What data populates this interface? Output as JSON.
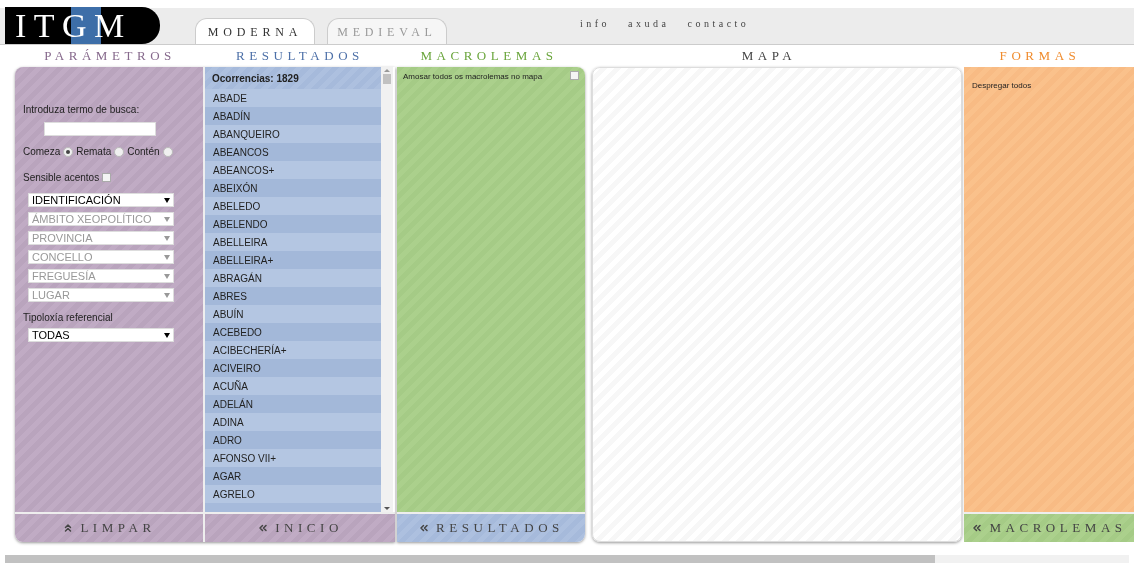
{
  "logo": {
    "text": "ITGM"
  },
  "tabs": [
    {
      "label": "MODERNA",
      "selected": true
    },
    {
      "label": "MEDIEVAL",
      "selected": false
    }
  ],
  "top_links": [
    "info",
    "axuda",
    "contacto"
  ],
  "section_headers": [
    {
      "label": "PARÁMETROS",
      "color": "#86698c"
    },
    {
      "label": "RESULTADOS",
      "color": "#4d70a8"
    },
    {
      "label": "MACROLEMAS",
      "color": "#6aa53c"
    },
    {
      "label": "MAPA",
      "color": "#444444"
    },
    {
      "label": "FORMAS",
      "color": "#f08c2e"
    }
  ],
  "parameters": {
    "search_label": "Introduza termo de busca:",
    "match_options": [
      {
        "label": "Comeza",
        "selected": true
      },
      {
        "label": "Remata",
        "selected": false
      },
      {
        "label": "Contén",
        "selected": false
      }
    ],
    "accent_sensitive": {
      "label": "Sensible acentos",
      "checked": false
    },
    "selects": [
      {
        "value": "IDENTIFICACIÓN",
        "disabled": false
      },
      {
        "value": "ÁMBITO XEOPOLÍTICO",
        "disabled": true
      },
      {
        "value": "PROVINCIA",
        "disabled": true
      },
      {
        "value": "CONCELLO",
        "disabled": true
      },
      {
        "value": "FREGUESÍA",
        "disabled": true
      },
      {
        "value": "LUGAR",
        "disabled": true
      }
    ],
    "typology": {
      "label": "Tipoloxía referencial",
      "value": "TODAS"
    },
    "button": "LIMPAR"
  },
  "results": {
    "count": "Ocorrencias: 1829",
    "items": [
      "ABADE",
      "ABADÍN",
      "ABANQUEIRO",
      "ABEANCOS",
      "ABEANCOS+",
      "ABEIXÓN",
      "ABELEDO",
      "ABELENDO",
      "ABELLEIRA",
      "ABELLEIRA+",
      "ABRAGÁN",
      "ABRES",
      "ABUÍN",
      "ACEBEDO",
      "ACIBECHERÍA+",
      "ACIVEIRO",
      "ACUÑA",
      "ADELÁN",
      "ADINA",
      "ADRO",
      "AFONSO VII+",
      "AGAR",
      "AGRELO"
    ],
    "button": "INICIO"
  },
  "macrolemas": {
    "show_all": {
      "label": "Amosar todos os macrolemas no mapa",
      "checked": false
    },
    "button": "RESULTADOS"
  },
  "formas": {
    "expand_all": "Despregar todos",
    "button": "MACROLEMAS"
  }
}
